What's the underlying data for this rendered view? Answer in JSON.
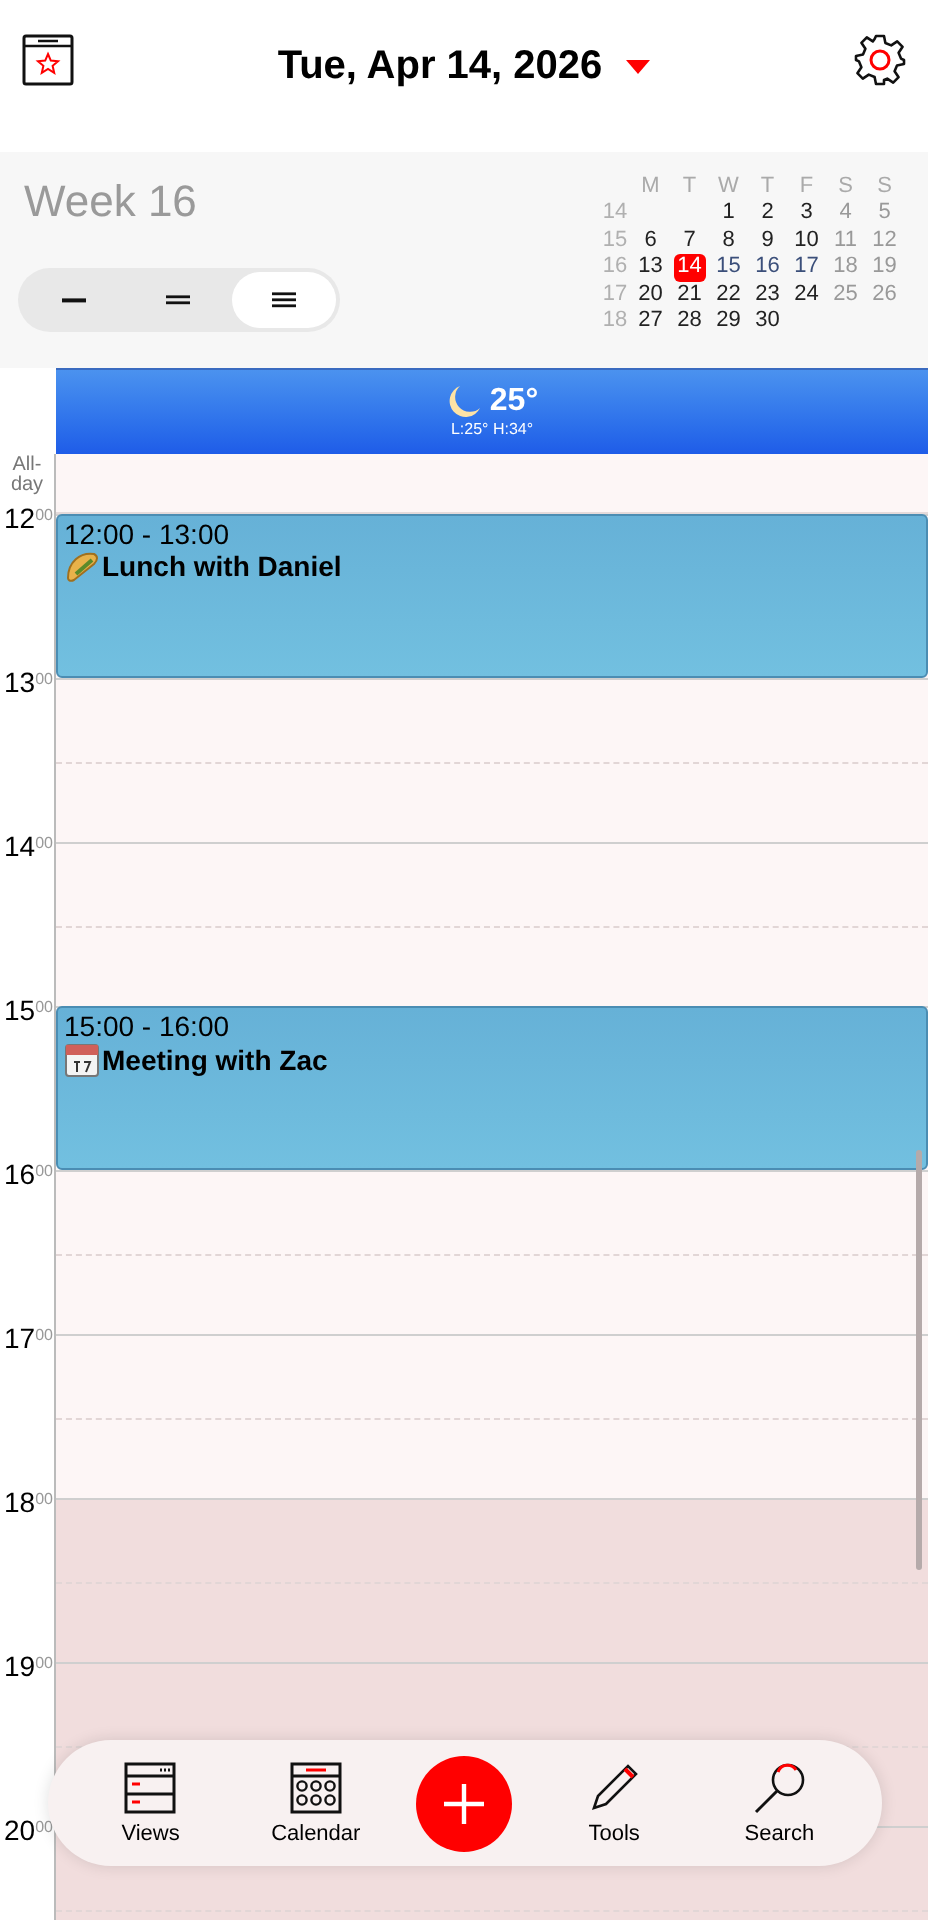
{
  "header": {
    "title": "Tue, Apr 14, 2026"
  },
  "week_label": "Week 16",
  "view_modes": [
    {
      "kind": "single",
      "selected": false
    },
    {
      "kind": "double",
      "selected": false
    },
    {
      "kind": "triple",
      "selected": true
    }
  ],
  "mini_calendar": {
    "weekdays": [
      "M",
      "T",
      "W",
      "T",
      "F",
      "S",
      "S"
    ],
    "weeks": [
      {
        "number": "14",
        "days": [
          {
            "label": "1",
            "weekend": false,
            "highlight": false,
            "selected": false
          },
          {
            "label": "2",
            "weekend": false,
            "highlight": false,
            "selected": false
          },
          {
            "label": "3",
            "weekend": false,
            "highlight": false,
            "selected": false
          },
          {
            "label": "4",
            "weekend": true,
            "highlight": false,
            "selected": false
          },
          {
            "label": "5",
            "weekend": true,
            "highlight": false,
            "selected": false
          }
        ]
      },
      {
        "number": "15",
        "days": [
          {
            "label": "6",
            "weekend": false,
            "highlight": false,
            "selected": false
          },
          {
            "label": "7",
            "weekend": false,
            "highlight": false,
            "selected": false
          },
          {
            "label": "8",
            "weekend": false,
            "highlight": false,
            "selected": false
          },
          {
            "label": "9",
            "weekend": false,
            "highlight": false,
            "selected": false
          },
          {
            "label": "10",
            "weekend": false,
            "highlight": false,
            "selected": false
          },
          {
            "label": "11",
            "weekend": true,
            "highlight": false,
            "selected": false
          },
          {
            "label": "12",
            "weekend": true,
            "highlight": false,
            "selected": false
          }
        ]
      },
      {
        "number": "16",
        "days": [
          {
            "label": "13",
            "weekend": false,
            "highlight": false,
            "selected": false
          },
          {
            "label": "14",
            "weekend": false,
            "highlight": false,
            "selected": true
          },
          {
            "label": "15",
            "weekend": false,
            "highlight": true,
            "selected": false
          },
          {
            "label": "16",
            "weekend": false,
            "highlight": true,
            "selected": false
          },
          {
            "label": "17",
            "weekend": false,
            "highlight": true,
            "selected": false
          },
          {
            "label": "18",
            "weekend": true,
            "highlight": false,
            "selected": false
          },
          {
            "label": "19",
            "weekend": true,
            "highlight": false,
            "selected": false
          }
        ]
      },
      {
        "number": "17",
        "days": [
          {
            "label": "20",
            "weekend": false,
            "highlight": false,
            "selected": false
          },
          {
            "label": "21",
            "weekend": false,
            "highlight": false,
            "selected": false
          },
          {
            "label": "22",
            "weekend": false,
            "highlight": false,
            "selected": false
          },
          {
            "label": "23",
            "weekend": false,
            "highlight": false,
            "selected": false
          },
          {
            "label": "24",
            "weekend": false,
            "highlight": false,
            "selected": false
          },
          {
            "label": "25",
            "weekend": true,
            "highlight": false,
            "selected": false
          },
          {
            "label": "26",
            "weekend": true,
            "highlight": false,
            "selected": false
          }
        ]
      },
      {
        "number": "18",
        "days": [
          {
            "label": "27",
            "weekend": false,
            "highlight": false,
            "selected": false
          },
          {
            "label": "28",
            "weekend": false,
            "highlight": false,
            "selected": false
          },
          {
            "label": "29",
            "weekend": false,
            "highlight": false,
            "selected": false
          },
          {
            "label": "30",
            "weekend": false,
            "highlight": false,
            "selected": false
          }
        ]
      }
    ]
  },
  "weather": {
    "temperature": "25°",
    "range": "L:25° H:34°"
  },
  "all_day_label": "All-day",
  "hours": [
    {
      "label": "12$^{00}$",
      "shaded": false,
      "events": [
        {
          "kind": "taco",
          "time": "12:00 - 13:00",
          "title": "Lunch with Daniel"
        }
      ]
    },
    {
      "label": "13$^{00}$",
      "shaded": false
    },
    {
      "label": "14$^{00}$",
      "shaded": false
    },
    {
      "label": "15$^{00}$",
      "shaded": false,
      "events": [
        {
          "kind": "calendar",
          "time": "15:00 - 16:00",
          "title": "Meeting with Zac"
        }
      ]
    },
    {
      "label": "16$^{00}$",
      "shaded": false
    },
    {
      "label": "17$^{00}$",
      "shaded": false
    },
    {
      "label": "18$^{00}$",
      "shaded": true
    },
    {
      "label": "19$^{00}$",
      "shaded": true
    },
    {
      "label": "20$^{00}$",
      "shaded": true
    }
  ],
  "bottom_nav": [
    {
      "kind": "views",
      "label": "Views"
    },
    {
      "kind": "calendar",
      "label": "Calendar"
    },
    {
      "kind": "add"
    },
    {
      "kind": "tools",
      "label": "Tools"
    },
    {
      "kind": "search",
      "label": "Search"
    }
  ]
}
